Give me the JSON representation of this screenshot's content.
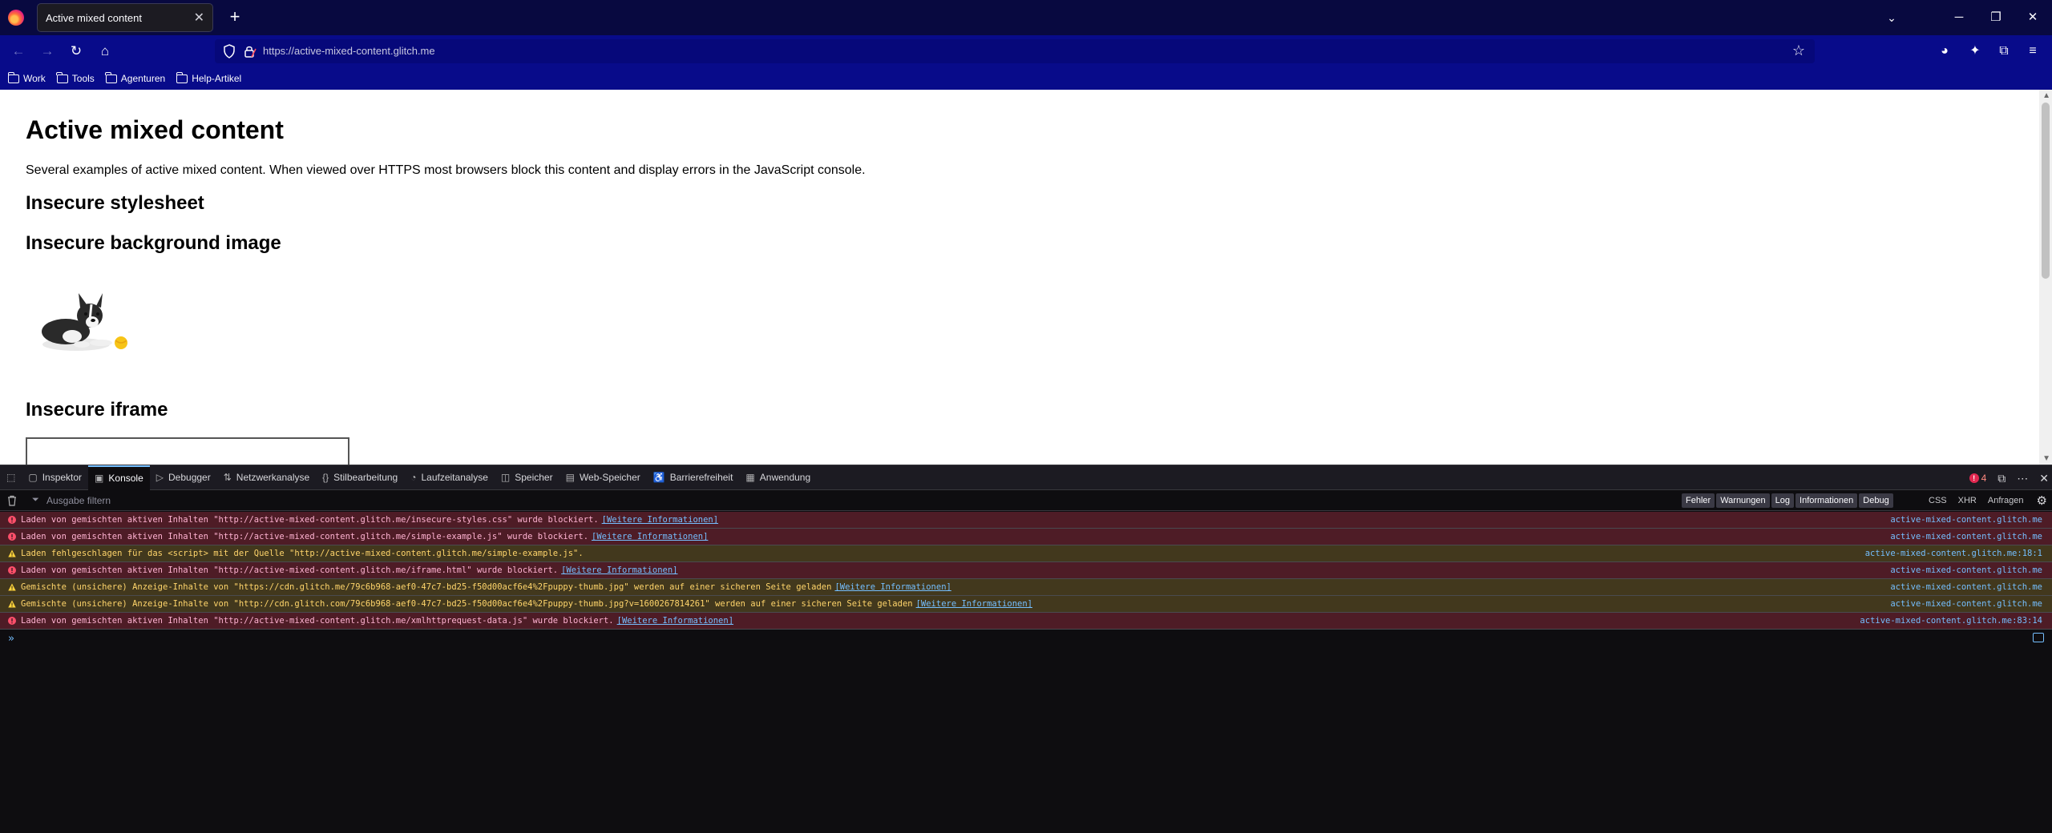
{
  "browser": {
    "tab_title": "Active mixed content",
    "url": "https://active-mixed-content.glitch.me",
    "bookmarks": [
      "Work",
      "Tools",
      "Agenturen",
      "Help-Artikel"
    ]
  },
  "page": {
    "title": "Active mixed content",
    "intro": "Several examples of active mixed content. When viewed over HTTPS most browsers block this content and display errors in the JavaScript console.",
    "h_stylesheet": "Insecure stylesheet",
    "h_background": "Insecure background image",
    "h_iframe": "Insecure iframe"
  },
  "devtools": {
    "tabs": [
      {
        "label": "Inspektor",
        "icon": "inspector-icon"
      },
      {
        "label": "Konsole",
        "icon": "console-icon"
      },
      {
        "label": "Debugger",
        "icon": "debugger-icon"
      },
      {
        "label": "Netzwerkanalyse",
        "icon": "network-icon"
      },
      {
        "label": "Stilbearbeitung",
        "icon": "style-editor-icon"
      },
      {
        "label": "Laufzeitanalyse",
        "icon": "performance-icon"
      },
      {
        "label": "Speicher",
        "icon": "memory-icon"
      },
      {
        "label": "Web-Speicher",
        "icon": "storage-icon"
      },
      {
        "label": "Barrierefreiheit",
        "icon": "accessibility-icon"
      },
      {
        "label": "Anwendung",
        "icon": "application-icon"
      }
    ],
    "error_count": "4",
    "filter_placeholder": "Ausgabe filtern",
    "levels": [
      "Fehler",
      "Warnungen",
      "Log",
      "Informationen",
      "Debug"
    ],
    "request_filters": [
      "CSS",
      "XHR",
      "Anfragen"
    ],
    "messages": [
      {
        "type": "error",
        "text": "Laden von gemischten aktiven Inhalten \"http://active-mixed-content.glitch.me/insecure-styles.css\" wurde blockiert.",
        "link": "[Weitere Informationen]",
        "location": "active-mixed-content.glitch.me"
      },
      {
        "type": "error",
        "text": "Laden von gemischten aktiven Inhalten \"http://active-mixed-content.glitch.me/simple-example.js\" wurde blockiert.",
        "link": "[Weitere Informationen]",
        "location": "active-mixed-content.glitch.me"
      },
      {
        "type": "warning",
        "text": "Laden fehlgeschlagen für das <script> mit der Quelle \"http://active-mixed-content.glitch.me/simple-example.js\".",
        "link": "",
        "location": "active-mixed-content.glitch.me:18:1"
      },
      {
        "type": "error",
        "text": "Laden von gemischten aktiven Inhalten \"http://active-mixed-content.glitch.me/iframe.html\" wurde blockiert.",
        "link": "[Weitere Informationen]",
        "location": "active-mixed-content.glitch.me"
      },
      {
        "type": "warning",
        "text": "Gemischte (unsichere) Anzeige-Inhalte von \"https://cdn.glitch.me/79c6b968-aef0-47c7-bd25-f50d00acf6e4%2Fpuppy-thumb.jpg\" werden auf einer sicheren Seite geladen",
        "link": "[Weitere Informationen]",
        "location": "active-mixed-content.glitch.me"
      },
      {
        "type": "warning",
        "text": "Gemischte (unsichere) Anzeige-Inhalte von \"http://cdn.glitch.com/79c6b968-aef0-47c7-bd25-f50d00acf6e4%2Fpuppy-thumb.jpg?v=1600267814261\" werden auf einer sicheren Seite geladen",
        "link": "[Weitere Informationen]",
        "location": "active-mixed-content.glitch.me"
      },
      {
        "type": "error",
        "text": "Laden von gemischten aktiven Inhalten \"http://active-mixed-content.glitch.me/xmlhttprequest-data.js\" wurde blockiert.",
        "link": "[Weitere Informationen]",
        "location": "active-mixed-content.glitch.me:83:14"
      }
    ]
  }
}
